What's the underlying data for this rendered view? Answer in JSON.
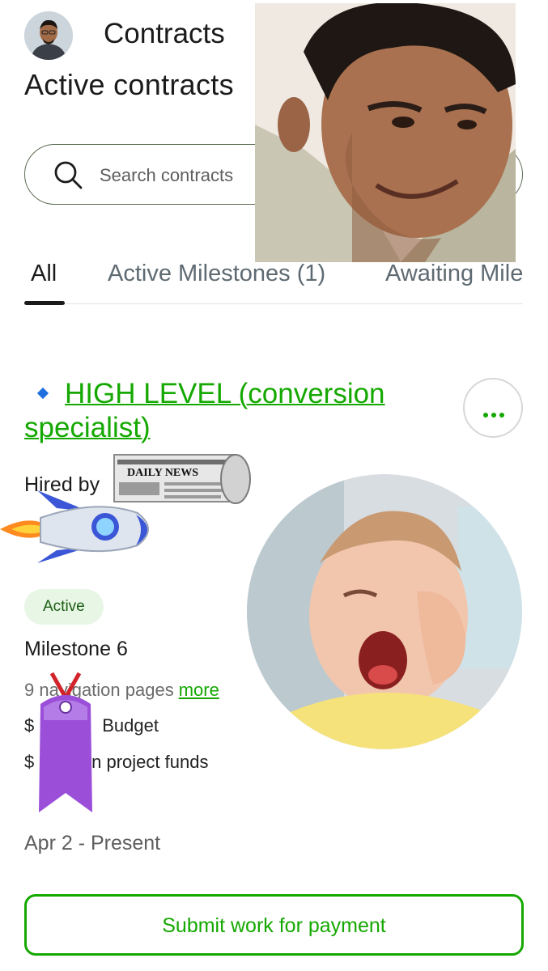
{
  "header": {
    "title": "Contracts",
    "section_title": "Active contracts"
  },
  "search": {
    "placeholder": "Search contracts"
  },
  "tabs": [
    {
      "label": "All",
      "selected": true
    },
    {
      "label": "Active Milestones (1)",
      "selected": false
    },
    {
      "label": "Awaiting Mile",
      "selected": false
    }
  ],
  "contract": {
    "title": "HIGH LEVEL (conversion specialist)",
    "hired_by": "Hired by",
    "status": "Active",
    "milestone": "Milestone 6",
    "milestone_description": "9 navigation pages",
    "more_link": "more",
    "budget": "Budget",
    "funds": "in project funds",
    "date_range": "Apr 2 - Present",
    "submit_label": "Submit work for payment"
  },
  "colors": {
    "brand_green": "#14a800",
    "text": "#1b1b1b",
    "muted": "#5e6a72",
    "badge_bg": "#e8f6e6"
  },
  "overlays": {
    "newspaper_text": "DAILY NEWS"
  }
}
